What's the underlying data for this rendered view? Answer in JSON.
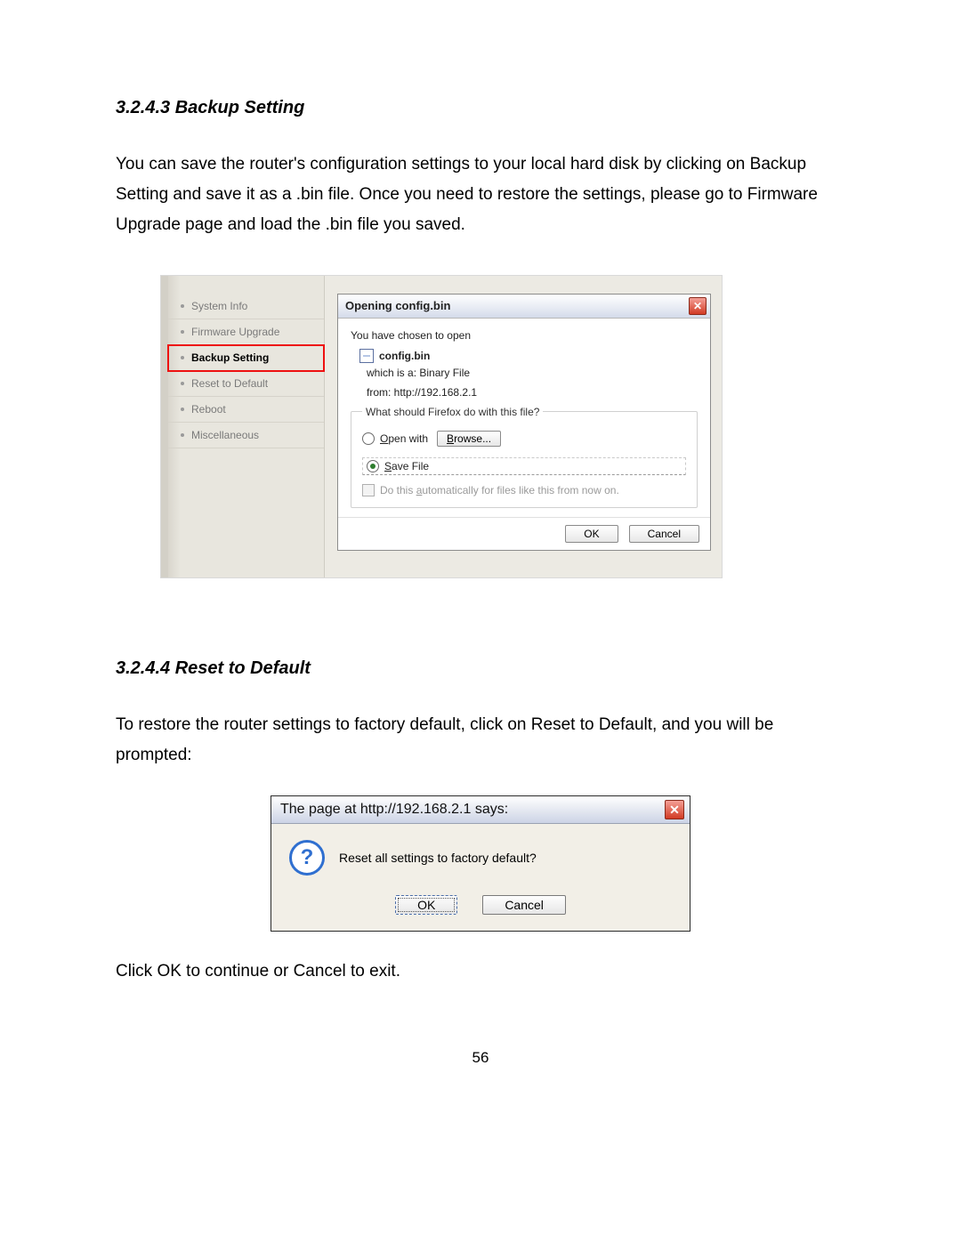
{
  "section1": {
    "heading": "3.2.4.3 Backup Setting",
    "paragraph": "You can save the router's configuration settings to your local hard disk by clicking on Backup Setting and save it as a .bin file. Once you need to restore the settings, please go to Firmware Upgrade page and load the .bin file you saved."
  },
  "sidebar": {
    "items": [
      {
        "label": "System Info"
      },
      {
        "label": "Firmware Upgrade"
      },
      {
        "label": "Backup Setting"
      },
      {
        "label": "Reset to Default"
      },
      {
        "label": "Reboot"
      },
      {
        "label": "Miscellaneous"
      }
    ]
  },
  "download_dialog": {
    "title": "Opening config.bin",
    "intro": "You have chosen to open",
    "filename": "config.bin",
    "which_is": "which is a:  Binary File",
    "from": "from:  http://192.168.2.1",
    "fieldset_legend": "What should Firefox do with this file?",
    "open_with_label": "Open with",
    "browse_label": "Browse...",
    "save_file_label": "Save File",
    "auto_label": "Do this automatically for files like this from now on.",
    "ok": "OK",
    "cancel": "Cancel"
  },
  "section2": {
    "heading": "3.2.4.4 Reset to Default",
    "paragraph": "To restore the router settings to factory default, click on Reset to Default, and you will be prompted:",
    "closing": "Click OK to continue or Cancel to exit."
  },
  "alert": {
    "title": "The page at http://192.168.2.1 says:",
    "message": "Reset all settings to factory default?",
    "ok": "OK",
    "cancel": "Cancel"
  },
  "page_number": "56"
}
